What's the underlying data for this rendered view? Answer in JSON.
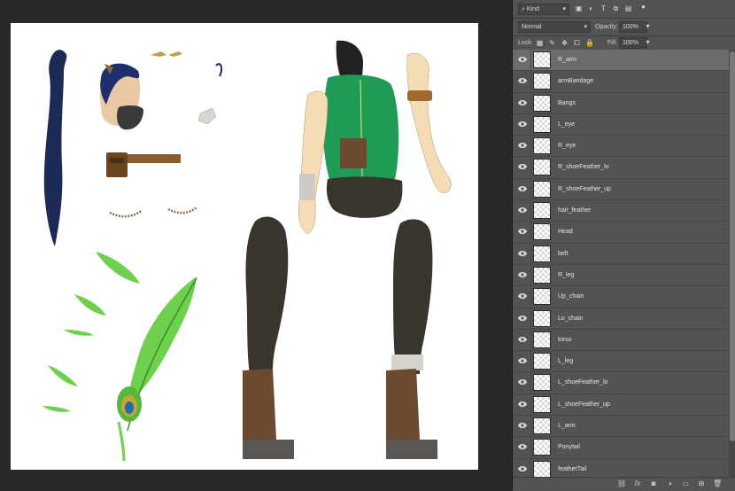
{
  "filter": {
    "kind_label": "Kind"
  },
  "blend": {
    "mode": "Normal",
    "opacity_label": "Opacity:",
    "opacity_value": "100%",
    "fill_label": "Fill:",
    "fill_value": "100%",
    "lock_label": "Lock:"
  },
  "layers": [
    {
      "name": "R_arm",
      "selected": true
    },
    {
      "name": "armBandage"
    },
    {
      "name": "Bangs"
    },
    {
      "name": "L_eye"
    },
    {
      "name": "R_eye"
    },
    {
      "name": "R_shoeFeather_lo"
    },
    {
      "name": "R_shoeFeather_up"
    },
    {
      "name": "hair_feather"
    },
    {
      "name": "Head"
    },
    {
      "name": "belt"
    },
    {
      "name": "R_leg"
    },
    {
      "name": "Up_chain"
    },
    {
      "name": "Lo_chain"
    },
    {
      "name": "torso"
    },
    {
      "name": "L_leg"
    },
    {
      "name": "L_shoeFeather_lo"
    },
    {
      "name": "L_shoeFeather_up"
    },
    {
      "name": "L_arm"
    },
    {
      "name": "Ponytail"
    },
    {
      "name": "featherTail"
    }
  ],
  "bottom_icons": [
    "link-icon",
    "fx-icon",
    "mask-icon",
    "adjustment-icon",
    "group-folder-icon",
    "new-layer-icon",
    "trash-icon"
  ],
  "colors": {
    "panel": "#535353",
    "selected_row": "#6b6b6b",
    "vest": "#1f9b55",
    "feather": "#6fd04d"
  }
}
